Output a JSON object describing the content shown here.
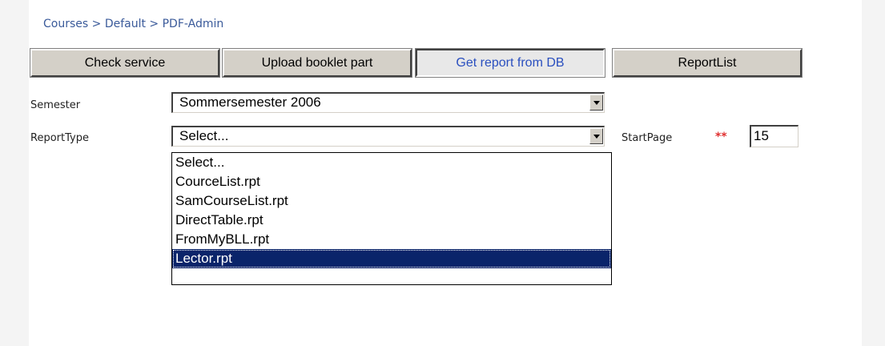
{
  "breadcrumb": {
    "items": [
      "Courses",
      "Default",
      "PDF-Admin"
    ],
    "separator": ">"
  },
  "tabs": [
    {
      "label": "Check service",
      "active": false
    },
    {
      "label": "Upload booklet part",
      "active": false
    },
    {
      "label": "Get report from DB",
      "active": true
    },
    {
      "label": "ReportList",
      "active": false
    }
  ],
  "form": {
    "semester_label": "Semester",
    "semester_value": "Sommersemester 2006",
    "reporttype_label": "ReportType",
    "reporttype_value": "Select...",
    "reporttype_options": [
      "Select...",
      "CourceList.rpt",
      "SamCourseList.rpt",
      "DirectTable.rpt",
      "FromMyBLL.rpt",
      "Lector.rpt"
    ],
    "reporttype_highlighted": "Lector.rpt",
    "startpage_label": "StartPage",
    "required_marker": "**",
    "startpage_value": "15"
  },
  "colors": {
    "link": "#3a5a9a",
    "active_tab_text": "#2a4fbf",
    "selection": "#0a246a",
    "required": "#e03030"
  }
}
